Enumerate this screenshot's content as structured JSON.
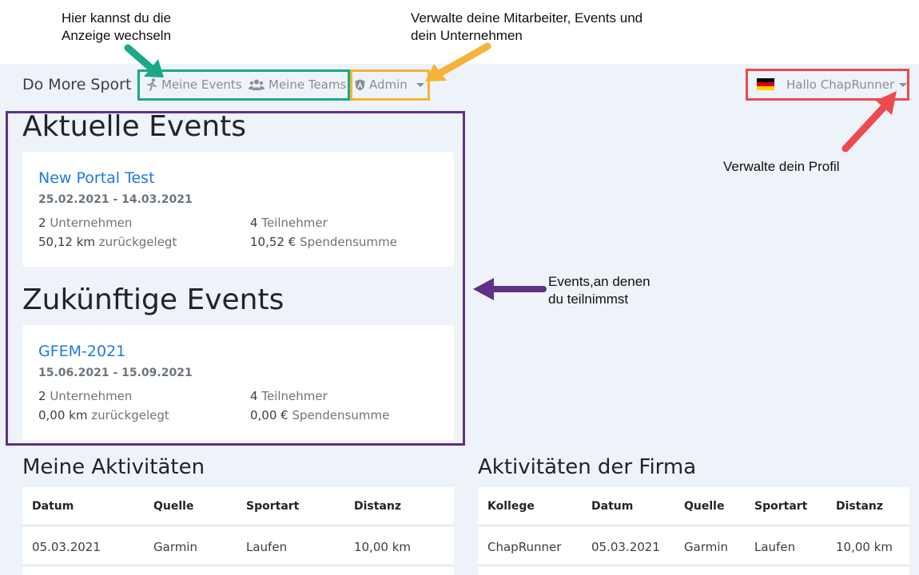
{
  "annotations": {
    "switch_view": [
      "Hier kannst du die",
      "Anzeige wechseln"
    ],
    "manage": [
      "Verwalte deine Mitarbeiter, Events und",
      "dein Unternehmen"
    ],
    "profile": "Verwalte dein Profil",
    "events": [
      "Events,an denen",
      "du teilnimmst"
    ]
  },
  "navbar": {
    "brand": "Do More Sport",
    "my_events": "Meine Events",
    "my_teams": "Meine Teams",
    "admin": "Admin",
    "user_greeting": "Hallo ChapRunner"
  },
  "current_events": {
    "heading": "Aktuelle Events",
    "event": {
      "title": "New Portal Test",
      "dates": "25.02.2021 - 14.03.2021",
      "companies_count": "2",
      "companies_label": "Unternehmen",
      "participants_count": "4",
      "participants_label": "Teilnehmer",
      "distance_value": "50,12 km",
      "distance_label": "zurückgelegt",
      "donation_value": "10,52 €",
      "donation_label": "Spendensumme"
    }
  },
  "future_events": {
    "heading": "Zukünftige Events",
    "event": {
      "title": "GFEM-2021",
      "dates": "15.06.2021 - 15.09.2021",
      "companies_count": "2",
      "companies_label": "Unternehmen",
      "participants_count": "4",
      "participants_label": "Teilnehmer",
      "distance_value": "0,00 km",
      "distance_label": "zurückgelegt",
      "donation_value": "0,00 €",
      "donation_label": "Spendensumme"
    }
  },
  "my_activities": {
    "heading": "Meine Aktivitäten",
    "columns": [
      "Datum",
      "Quelle",
      "Sportart",
      "Distanz"
    ],
    "rows": [
      [
        "05.03.2021",
        "Garmin",
        "Laufen",
        "10,00 km"
      ]
    ]
  },
  "company_activities": {
    "heading": "Aktivitäten der Firma",
    "columns": [
      "Kollege",
      "Datum",
      "Quelle",
      "Sportart",
      "Distanz"
    ],
    "rows": [
      [
        "ChapRunner",
        "05.03.2021",
        "Garmin",
        "Laufen",
        "10,00 km"
      ]
    ]
  },
  "colors": {
    "green": "#1aa889",
    "orange": "#f5b33a",
    "red": "#ec4a4c",
    "purple": "#5d3286",
    "link": "#1f7ae0"
  }
}
